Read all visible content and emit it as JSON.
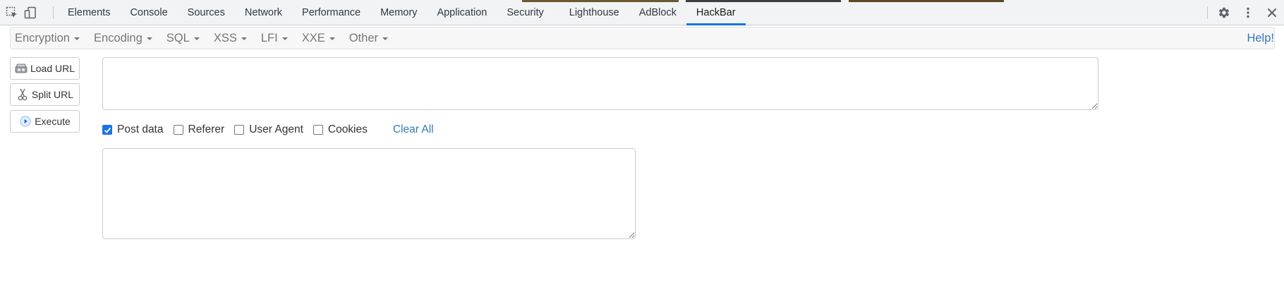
{
  "devtools": {
    "tabs": [
      {
        "label": "Elements"
      },
      {
        "label": "Console"
      },
      {
        "label": "Sources"
      },
      {
        "label": "Network"
      },
      {
        "label": "Performance"
      },
      {
        "label": "Memory"
      },
      {
        "label": "Application"
      },
      {
        "label": "Security"
      },
      {
        "label": "Lighthouse"
      },
      {
        "label": "AdBlock"
      },
      {
        "label": "HackBar"
      }
    ],
    "active_tab": "HackBar",
    "left_icons": [
      "inspect-element-icon",
      "device-toolbar-icon"
    ],
    "right_icons": [
      "settings-gear-icon",
      "more-options-icon",
      "close-icon"
    ],
    "active_tab_color": "#1a73e8"
  },
  "hackbar": {
    "menu": [
      {
        "label": "Encryption"
      },
      {
        "label": "Encoding"
      },
      {
        "label": "SQL"
      },
      {
        "label": "XSS"
      },
      {
        "label": "LFI"
      },
      {
        "label": "XXE"
      },
      {
        "label": "Other"
      }
    ],
    "help_label": "Help!",
    "buttons": {
      "load_url": "Load URL",
      "split_url": "Split URL",
      "execute": "Execute"
    },
    "url_value": "",
    "options": {
      "post_data": {
        "label": "Post data",
        "checked": true
      },
      "referer": {
        "label": "Referer",
        "checked": false
      },
      "user_agent": {
        "label": "User Agent",
        "checked": false
      },
      "cookies": {
        "label": "Cookies",
        "checked": false
      }
    },
    "clear_all_label": "Clear All",
    "post_data_value": "",
    "link_color": "#337ab7"
  }
}
